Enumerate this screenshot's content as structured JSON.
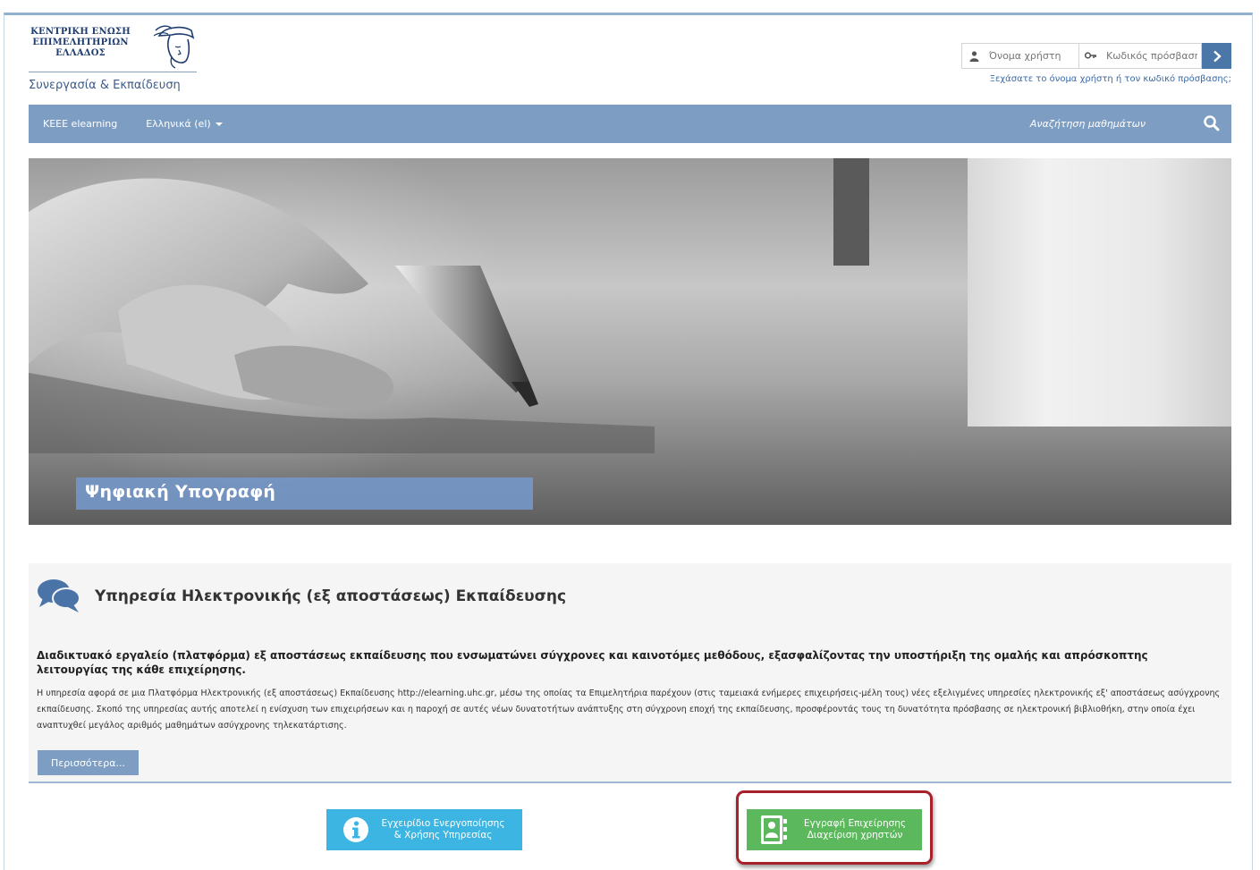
{
  "logo": {
    "line1": "ΚΕΝΤΡΙΚΗ ΕΝΩΣΗ",
    "line2": "ΕΠΙΜΕΛΗΤΗΡΙΩΝ",
    "line3": "ΕΛΛΑΔΟΣ",
    "tagline": "Συνεργασία & Εκπαίδευση"
  },
  "login": {
    "username_placeholder": "Όνομα χρήστη",
    "password_placeholder": "Κωδικός πρόσβασης",
    "forgot_link": "Ξεχάσατε το όνομα χρήστη ή τον κωδικό πρόσβασης;"
  },
  "navbar": {
    "brand": "KEEE elearning",
    "language": "Ελληνικά (el)",
    "search_label": "Αναζήτηση μαθημάτων"
  },
  "hero": {
    "caption": "Ψηφιακή Υπογραφή"
  },
  "info": {
    "title": "Υπηρεσία Ηλεκτρονικής (εξ αποστάσεως) Εκπαίδευσης",
    "lead": "Διαδικτυακό εργαλείο (πλατφόρμα) εξ αποστάσεως εκπαίδευσης που ενσωματώνει σύγχρονες και καινοτόμες μεθόδους, εξασφαλίζοντας την υποστήριξη της ομαλής και απρόσκοπτης λειτουργίας της κάθε επιχείρησης.",
    "body": "Η υπηρεσία αφορά σε μια Πλατφόρμα Ηλεκτρονικής (εξ αποστάσεως) Εκπαίδευσης http://elearning.uhc.gr, μέσω της οποίας τα Επιμελητήρια παρέχουν (στις ταμειακά ενήμερες επιχειρήσεις-μέλη τους) νέες εξελιγμένες υπηρεσίες ηλεκτρονικής εξ' αποστάσεως ασύγχρονης εκπαίδευσης. Σκοπό της υπηρεσίας αυτής αποτελεί η ενίσχυση των επιχειρήσεων και η παροχή σε αυτές νέων δυνατοτήτων ανάπτυξης στη σύγχρονη εποχή της εκπαίδευσης, προσφέροντάς τους τη δυνατότητα πρόσβασης σε ηλεκτρονική βιβλιοθήκη, στην οποία έχει αναπτυχθεί μεγάλος αριθμός μαθημάτων ασύγχρονης τηλεκατάρτισης.",
    "more_button": "Περισσότερα..."
  },
  "buttons": {
    "manual_line1": "Εγχειρίδιο Ενεργοποίησης",
    "manual_line2": "& Χρήσης Υπηρεσίας",
    "register_line1": "Εγγραφή Επιχείρησης",
    "register_line2": "Διαχείριση χρηστών"
  },
  "colors": {
    "navbar": "#7d9dc3",
    "login_button": "#4b76a8",
    "manual_button": "#3cb5e3",
    "register_button": "#5cb85c",
    "highlight_border": "#a8212a"
  }
}
